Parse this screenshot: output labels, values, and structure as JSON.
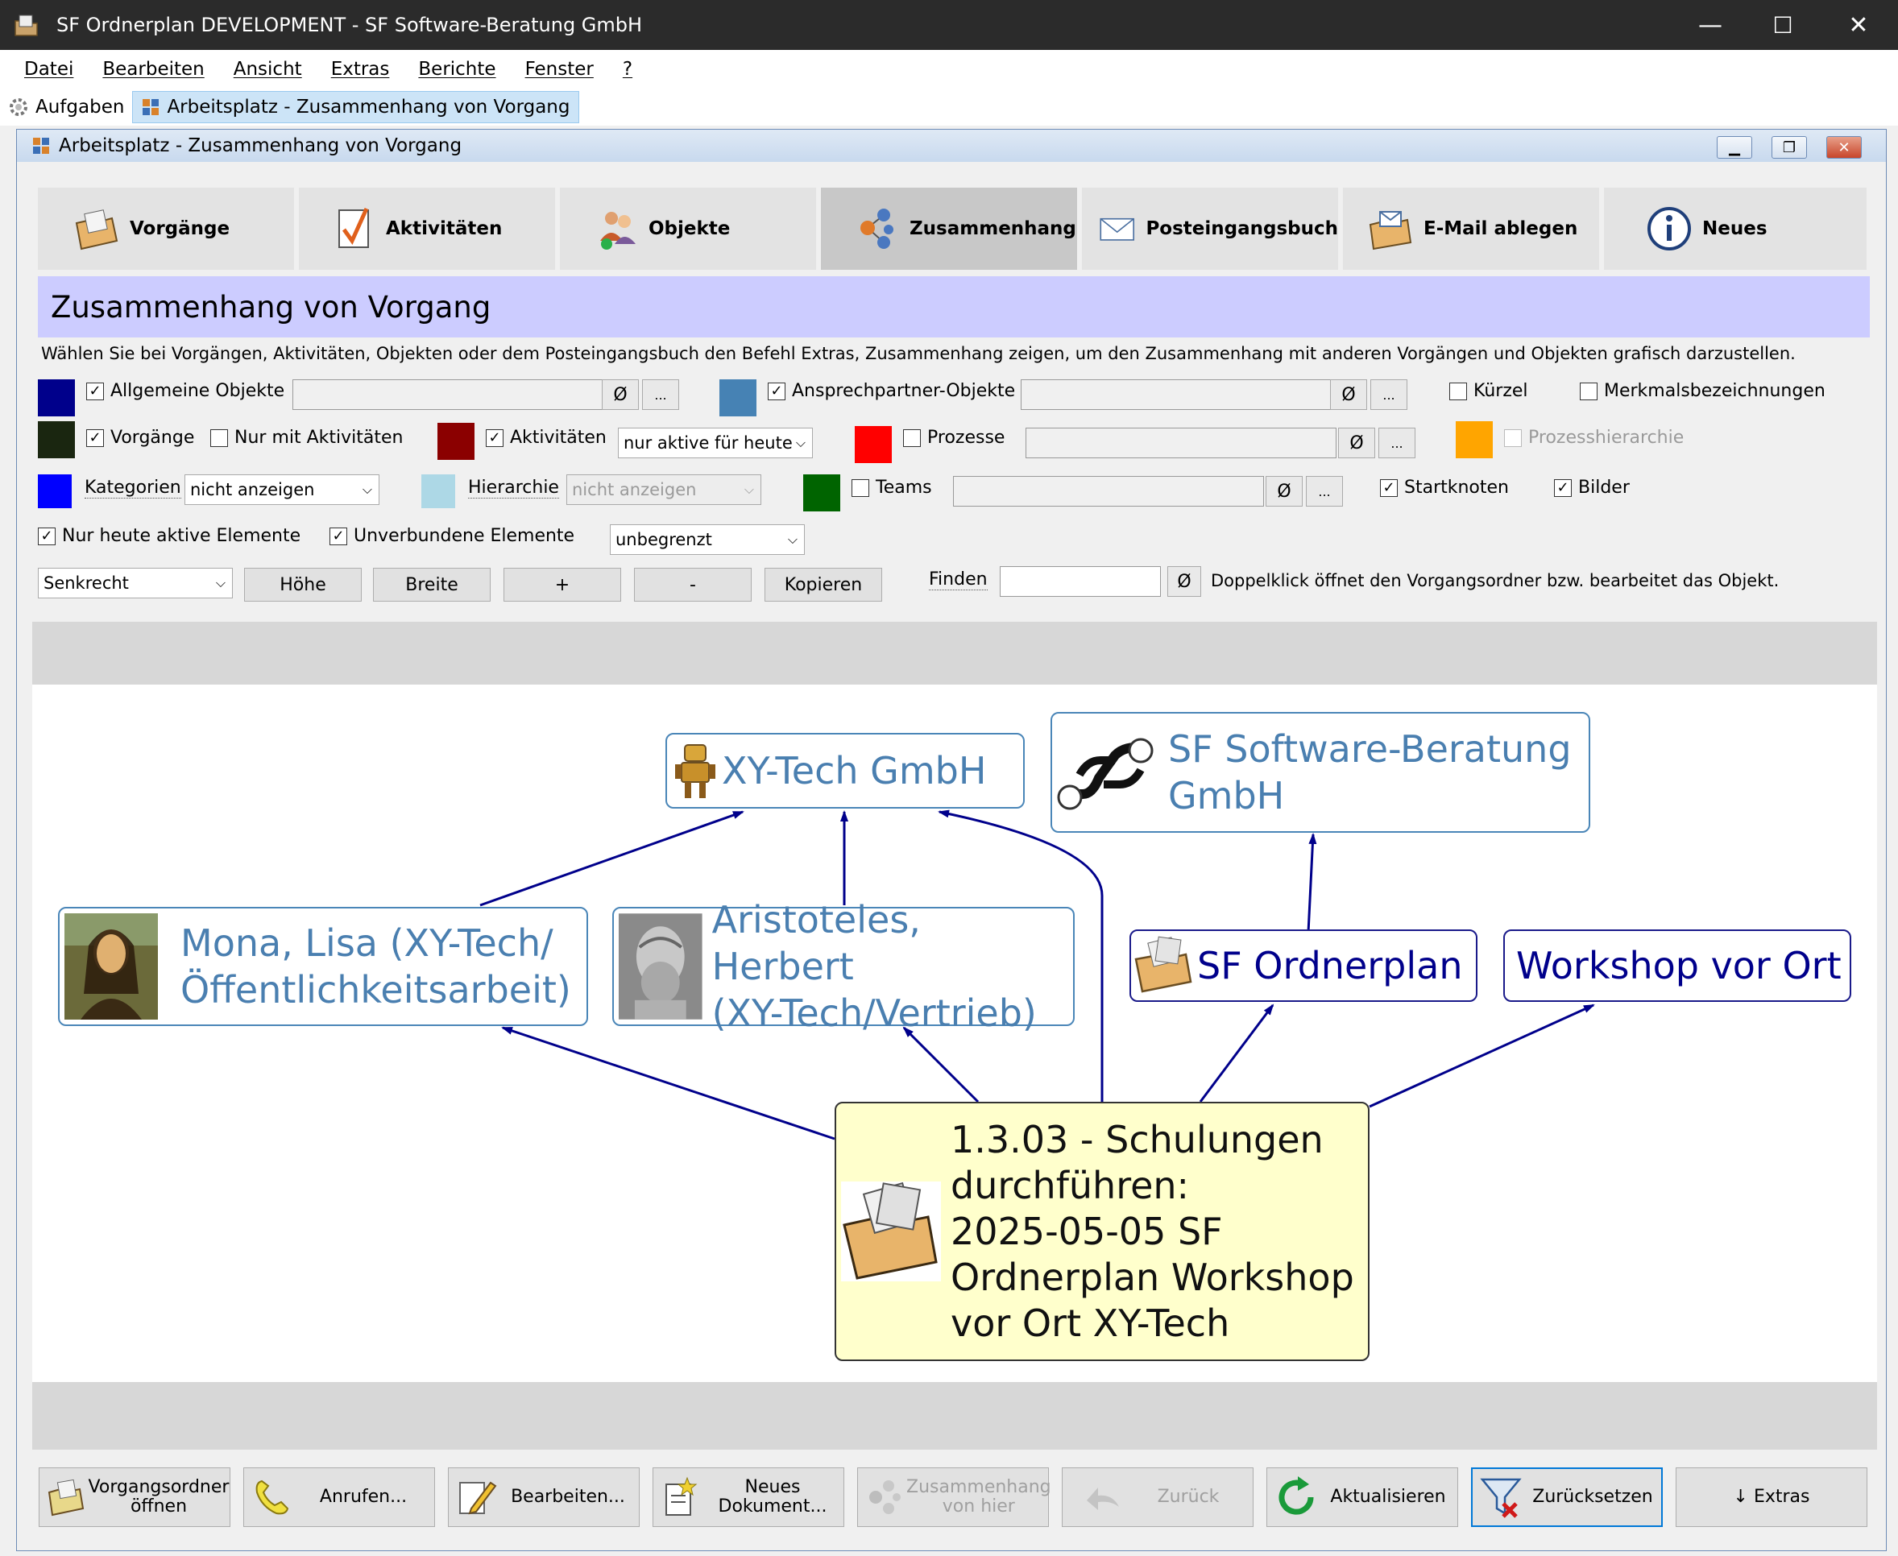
{
  "window": {
    "title": "SF Ordnerplan DEVELOPMENT - SF Software-Beratung GmbH",
    "minimize": "—",
    "maximize": "☐",
    "close": "✕"
  },
  "menu": [
    "Datei",
    "Bearbeiten",
    "Ansicht",
    "Extras",
    "Berichte",
    "Fenster",
    "?"
  ],
  "doc_tabs": [
    {
      "label": "Aufgaben",
      "active": false
    },
    {
      "label": "Arbeitsplatz - Zusammenhang von Vorgang",
      "active": true
    }
  ],
  "child_window": {
    "title": "Arbeitsplatz - Zusammenhang von Vorgang",
    "minimize": "▁",
    "restore": "❐",
    "close": "✕"
  },
  "nav": [
    {
      "label": "Vorgänge",
      "icon": "folder-icon",
      "active": false
    },
    {
      "label": "Aktivitäten",
      "icon": "checkmark-icon",
      "active": false
    },
    {
      "label": "Objekte",
      "icon": "people-icon",
      "active": false
    },
    {
      "label": "Zusammenhang",
      "icon": "network-icon",
      "active": true
    },
    {
      "label": "Posteingangsbuch",
      "icon": "envelope-icon",
      "active": false
    },
    {
      "label": "E-Mail ablegen",
      "icon": "email-folder-icon",
      "active": false
    },
    {
      "label": "Neues",
      "icon": "info-icon",
      "active": false
    }
  ],
  "header": {
    "title": "Zusammenhang von Vorgang",
    "hint": "Wählen Sie bei Vorgängen, Aktivitäten, Objekten oder dem Posteingangsbuch den Befehl Extras, Zusammenhang zeigen, um den Zusammenhang mit anderen Vorgängen und Objekten grafisch darzustellen."
  },
  "filters": {
    "allgemeine_objekte": {
      "label": "Allgemeine Objekte",
      "checked": true,
      "color": "#00008b"
    },
    "ansprechpartner": {
      "label": "Ansprechpartner-Objekte",
      "checked": true,
      "color": "#4682b4"
    },
    "kuerzel": {
      "label": "Kürzel",
      "checked": false
    },
    "merkmalsbezeichnungen": {
      "label": "Merkmalsbezeichnungen",
      "checked": false
    },
    "vorgaenge": {
      "label": "Vorgänge",
      "checked": true,
      "color": "#1a2610"
    },
    "nur_mit_aktivitaeten": {
      "label": "Nur mit Aktivitäten",
      "checked": false
    },
    "aktivitaeten": {
      "label": "Aktivitäten",
      "checked": true,
      "color": "#8b0000"
    },
    "aktivitaeten_select": "nur aktive für heute",
    "prozesse": {
      "label": "Prozesse",
      "checked": false,
      "color": "#ff0000"
    },
    "prozesshierarchie": {
      "label": "Prozesshierarchie",
      "checked": false,
      "color": "#ffa500"
    },
    "kategorien": {
      "label": "Kategorien",
      "color": "#0000ff",
      "select": "nicht anzeigen"
    },
    "hierarchie": {
      "label": "Hierarchie",
      "color": "#add8e6",
      "select": "nicht anzeigen"
    },
    "teams": {
      "label": "Teams",
      "checked": false,
      "color": "#006400"
    },
    "startknoten": {
      "label": "Startknoten",
      "checked": true
    },
    "bilder": {
      "label": "Bilder",
      "checked": true
    },
    "nur_heute_aktive": {
      "label": "Nur heute aktive Elemente",
      "checked": true
    },
    "unverbundene": {
      "label": "Unverbundene Elemente",
      "checked": true
    },
    "limit_select": "unbegrenzt",
    "clear_glyph": "Ø",
    "more_glyph": "..."
  },
  "layout_controls": {
    "orientation": "Senkrecht",
    "hoehe": "Höhe",
    "breite": "Breite",
    "plus": "+",
    "minus": "-",
    "kopieren": "Kopieren",
    "finden_label": "Finden",
    "finden_value": "",
    "finden_hint": "Doppelklick öffnet den Vorgangsordner bzw. bearbeitet das Objekt."
  },
  "graph": {
    "nodes": {
      "xytech": "XY-Tech GmbH",
      "sf_line1": "SF Software-Beratung",
      "sf_line2": "GmbH",
      "mona_line1": "Mona, Lisa (XY-Tech/",
      "mona_line2": "Öffentlichkeitsarbeit)",
      "aristoteles_line1": "Aristoteles, Herbert",
      "aristoteles_line2": "(XY-Tech/Vertrieb)",
      "ordnerplan": "SF Ordnerplan",
      "workshop": "Workshop vor Ort",
      "focus_lines": [
        "1.3.03 - Schulungen",
        "durchführen:",
        "2025-05-05 SF",
        "Ordnerplan Workshop",
        "vor Ort XY-Tech"
      ]
    },
    "edge_color": "#00008b"
  },
  "bottom_buttons": [
    {
      "label_line1": "Vorgangsordner",
      "label_line2": "öffnen",
      "icon": "folder-open-icon",
      "disabled": false
    },
    {
      "label_line1": "Anrufen...",
      "label_line2": "",
      "icon": "phone-icon",
      "disabled": false
    },
    {
      "label_line1": "Bearbeiten...",
      "label_line2": "",
      "icon": "pencil-icon",
      "disabled": false
    },
    {
      "label_line1": "Neues",
      "label_line2": "Dokument...",
      "icon": "new-document-icon",
      "disabled": false
    },
    {
      "label_line1": "Zusammenhang",
      "label_line2": "von hier",
      "icon": "network-icon",
      "disabled": true
    },
    {
      "label_line1": "Zurück",
      "label_line2": "",
      "icon": "back-arrow-icon",
      "disabled": true
    },
    {
      "label_line1": "Aktualisieren",
      "label_line2": "",
      "icon": "refresh-icon",
      "disabled": false
    },
    {
      "label_line1": "Zurücksetzen",
      "label_line2": "",
      "icon": "filter-reset-icon",
      "disabled": false
    },
    {
      "label_line1": "↓ Extras",
      "label_line2": "",
      "icon": "",
      "disabled": false
    }
  ]
}
